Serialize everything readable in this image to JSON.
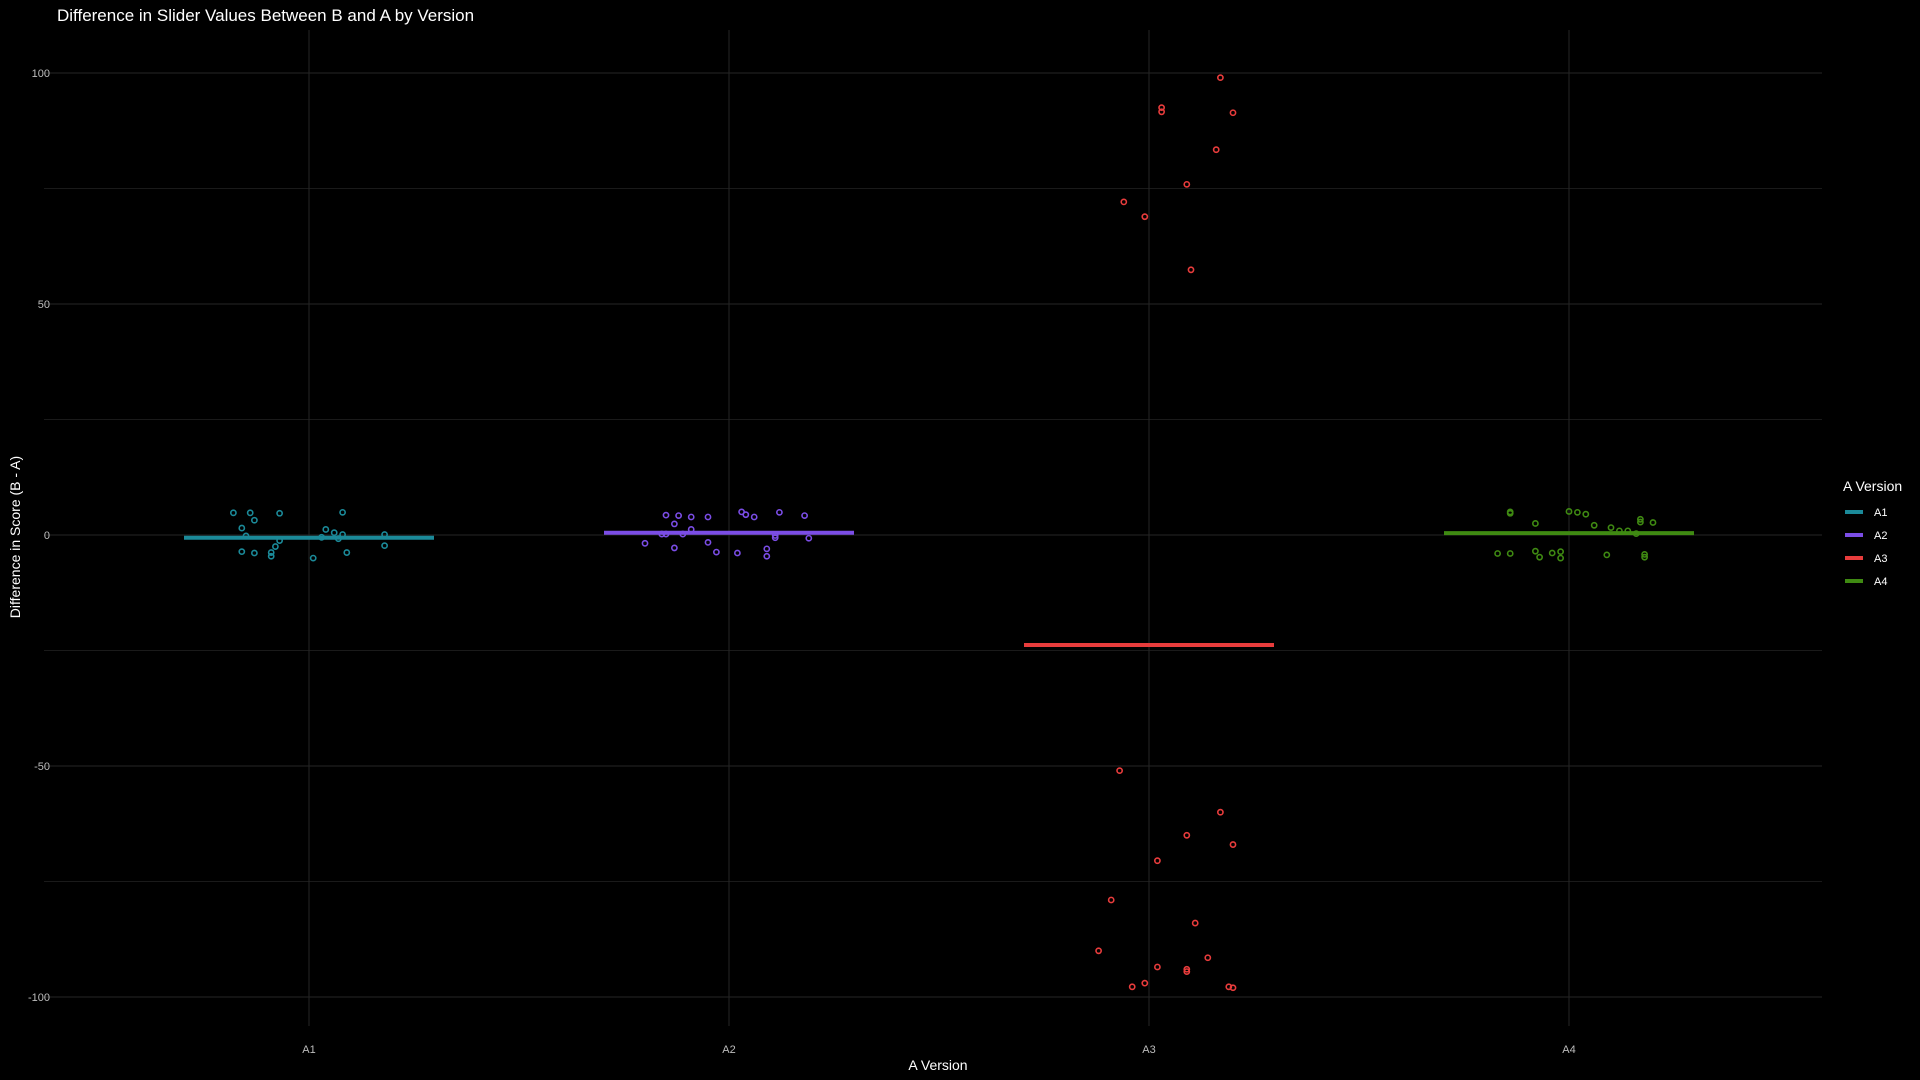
{
  "chart_data": {
    "type": "scatter",
    "title": "Difference in Slider Values Between B and A by Version",
    "xlabel": "A Version",
    "ylabel": "Difference in Score (B - A)",
    "categories": [
      "A1",
      "A2",
      "A3",
      "A4"
    ],
    "yticks": [
      -100,
      -50,
      0,
      50,
      100
    ],
    "ylim": [
      -108.5,
      108.5
    ],
    "grid": true,
    "background": "#000000",
    "legend": {
      "title": "A Version",
      "position": "right",
      "entries": [
        "A1",
        "A2",
        "A3",
        "A4"
      ]
    },
    "colors": {
      "A1": "#1b8a99",
      "A2": "#7b4de6",
      "A3": "#e83c3c",
      "A4": "#3f8a12"
    },
    "series": [
      {
        "name": "A1",
        "mean": -0.6,
        "points": [
          [
            -0.18,
            4.8
          ],
          [
            -0.14,
            4.8
          ],
          [
            -0.07,
            4.7
          ],
          [
            0.08,
            4.9
          ],
          [
            -0.13,
            3.2
          ],
          [
            -0.16,
            1.5
          ],
          [
            0.04,
            1.2
          ],
          [
            0.06,
            0.5
          ],
          [
            0.08,
            0.1
          ],
          [
            -0.15,
            -0.2
          ],
          [
            0.18,
            0.1
          ],
          [
            0.03,
            -0.5
          ],
          [
            0.07,
            -0.8
          ],
          [
            -0.07,
            -1.2
          ],
          [
            0.18,
            -2.3
          ],
          [
            -0.08,
            -2.5
          ],
          [
            -0.16,
            -3.6
          ],
          [
            -0.13,
            -3.9
          ],
          [
            0.09,
            -3.8
          ],
          [
            -0.09,
            -3.8
          ],
          [
            -0.09,
            -4.6
          ],
          [
            0.01,
            -5.0
          ]
        ]
      },
      {
        "name": "A2",
        "mean": 0.5,
        "points": [
          [
            0.03,
            5.0
          ],
          [
            0.04,
            4.4
          ],
          [
            0.12,
            4.9
          ],
          [
            0.18,
            4.2
          ],
          [
            -0.12,
            4.2
          ],
          [
            -0.15,
            4.3
          ],
          [
            -0.09,
            3.9
          ],
          [
            -0.05,
            3.9
          ],
          [
            0.06,
            3.9
          ],
          [
            -0.13,
            2.4
          ],
          [
            -0.09,
            1.2
          ],
          [
            -0.16,
            0.2
          ],
          [
            -0.15,
            0.2
          ],
          [
            -0.11,
            0.2
          ],
          [
            0.11,
            -0.1
          ],
          [
            0.11,
            -0.6
          ],
          [
            0.19,
            -0.7
          ],
          [
            -0.05,
            -1.6
          ],
          [
            -0.2,
            -1.8
          ],
          [
            -0.13,
            -2.8
          ],
          [
            0.09,
            -3.0
          ],
          [
            -0.03,
            -3.7
          ],
          [
            0.02,
            -3.9
          ],
          [
            0.09,
            -4.6
          ]
        ]
      },
      {
        "name": "A3",
        "mean": -23.8,
        "points": [
          [
            0.17,
            99.0
          ],
          [
            0.03,
            92.5
          ],
          [
            0.03,
            91.6
          ],
          [
            0.2,
            91.4
          ],
          [
            0.16,
            83.4
          ],
          [
            0.09,
            75.9
          ],
          [
            -0.06,
            72.1
          ],
          [
            -0.01,
            68.9
          ],
          [
            0.1,
            57.4
          ],
          [
            -0.07,
            -51.0
          ],
          [
            0.17,
            -60.0
          ],
          [
            0.09,
            -65.0
          ],
          [
            0.2,
            -67.0
          ],
          [
            0.02,
            -70.5
          ],
          [
            -0.09,
            -79.0
          ],
          [
            0.11,
            -84.0
          ],
          [
            -0.12,
            -90.0
          ],
          [
            0.14,
            -91.5
          ],
          [
            0.02,
            -93.5
          ],
          [
            0.09,
            -94.0
          ],
          [
            0.09,
            -94.5
          ],
          [
            -0.01,
            -97.0
          ],
          [
            -0.04,
            -97.8
          ],
          [
            0.19,
            -97.8
          ],
          [
            0.2,
            -98.0
          ]
        ]
      },
      {
        "name": "A4",
        "mean": 0.4,
        "points": [
          [
            -0.14,
            5.0
          ],
          [
            -0.14,
            4.7
          ],
          [
            0.0,
            5.1
          ],
          [
            0.02,
            4.9
          ],
          [
            0.04,
            4.5
          ],
          [
            0.17,
            3.4
          ],
          [
            0.17,
            2.8
          ],
          [
            0.2,
            2.7
          ],
          [
            -0.08,
            2.5
          ],
          [
            0.06,
            2.1
          ],
          [
            0.1,
            1.6
          ],
          [
            0.12,
            0.9
          ],
          [
            0.14,
            0.9
          ],
          [
            0.16,
            0.3
          ],
          [
            -0.08,
            -3.5
          ],
          [
            -0.02,
            -3.6
          ],
          [
            -0.04,
            -3.9
          ],
          [
            -0.14,
            -4.0
          ],
          [
            -0.17,
            -4.0
          ],
          [
            0.09,
            -4.3
          ],
          [
            0.18,
            -4.2
          ],
          [
            0.18,
            -4.8
          ],
          [
            -0.07,
            -4.8
          ],
          [
            -0.02,
            -5.0
          ]
        ]
      }
    ]
  }
}
